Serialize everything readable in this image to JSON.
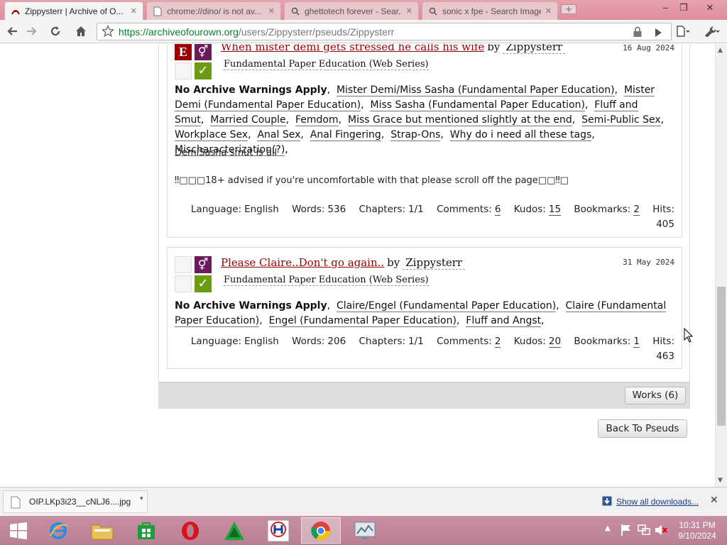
{
  "browser": {
    "tabs": [
      {
        "label": "Zippysterr | Archive of O...",
        "icon": "ao3-icon",
        "active": true
      },
      {
        "label": "chrome://dino/ is not av...",
        "icon": "page-icon",
        "active": false
      },
      {
        "label": "ghettotech forever - Sear...",
        "icon": "search-icon",
        "active": false
      },
      {
        "label": "sonic x fpe - Search Images",
        "icon": "search-icon",
        "active": false
      }
    ],
    "url_host": "https://archiveofourown.org",
    "url_path": "/users/Zippysterr/pseuds/Zippysterr"
  },
  "works": [
    {
      "rating_symbol": "E",
      "title": "When mister demi gets stressed he calls his wife",
      "by": "by",
      "author": "Zippysterr",
      "date": "16 Aug 2024",
      "fandom": "Fundamental Paper Education (Web Series)",
      "warning": "No Archive Warnings Apply",
      "tags": [
        "Mister Demi/Miss Sasha (Fundamental Paper Education)",
        "Mister Demi (Fundamental Paper Education)",
        "Miss Sasha (Fundamental Paper Education)",
        "Fluff and Smut",
        "Married Couple",
        "Femdom",
        "Miss Grace but mentioned slightly at the end",
        "Semi-Public Sex",
        "Workplace Sex",
        "Anal Sex",
        "Anal Fingering",
        "Strap-Ons",
        "Why do i need all these tags",
        "Mischaracterization(?)"
      ],
      "summary": [
        "DemiSasha smut is all",
        "‼□□□18+ advised if you're uncomfortable with that please scroll off the page□□‼□"
      ],
      "stats": {
        "language_label": "Language:",
        "language": "English",
        "words_label": "Words:",
        "words": "536",
        "chapters_label": "Chapters:",
        "chapters": "1/1",
        "comments_label": "Comments:",
        "comments": "6",
        "kudos_label": "Kudos:",
        "kudos": "15",
        "bookmarks_label": "Bookmarks:",
        "bookmarks": "2",
        "hits_label": "Hits:",
        "hits": "405"
      }
    },
    {
      "rating_symbol": "",
      "title": "Please Claire..Don't go again..",
      "by": "by",
      "author": "Zippysterr",
      "date": "31 May 2024",
      "fandom": "Fundamental Paper Education (Web Series)",
      "warning": "No Archive Warnings Apply",
      "tags": [
        "Claire/Engel (Fundamental Paper Education)",
        "Claire (Fundamental Paper Education)",
        "Engel (Fundamental Paper Education)",
        "Fluff and Angst"
      ],
      "stats": {
        "language_label": "Language:",
        "language": "English",
        "words_label": "Words:",
        "words": "206",
        "chapters_label": "Chapters:",
        "chapters": "1/1",
        "comments_label": "Comments:",
        "comments": "2",
        "kudos_label": "Kudos:",
        "kudos": "20",
        "bookmarks_label": "Bookmarks:",
        "bookmarks": "1",
        "hits_label": "Hits:",
        "hits": "463"
      }
    }
  ],
  "works_button": "Works (6)",
  "back_button": "Back To Pseuds",
  "downloads": {
    "file": "OIP.LKp3i23__cNLJ6....jpg",
    "show_all": "Show all downloads..."
  },
  "taskbar": {
    "time": "10:31 PM",
    "date": "9/10/2024"
  },
  "colors": {
    "ao3_red": "#990000",
    "complete_green": "#6a9b11",
    "category_purple": "#6d1a5d"
  }
}
